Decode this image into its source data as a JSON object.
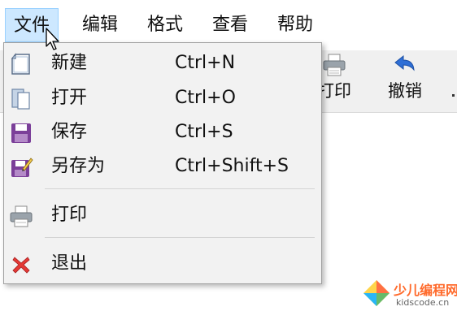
{
  "menubar": {
    "items": [
      {
        "label": "文件",
        "active": true
      },
      {
        "label": "编辑"
      },
      {
        "label": "格式"
      },
      {
        "label": "查看"
      },
      {
        "label": "帮助"
      }
    ]
  },
  "toolbar": {
    "buttons": [
      {
        "label": "打印",
        "icon": "printer-icon"
      },
      {
        "label": "撤销",
        "icon": "undo-icon"
      }
    ]
  },
  "file_menu": {
    "items": [
      {
        "label": "新建",
        "shortcut": "Ctrl+N",
        "icon": "new-document-icon"
      },
      {
        "label": "打开",
        "shortcut": "Ctrl+O",
        "icon": "open-document-icon"
      },
      {
        "label": "保存",
        "shortcut": "Ctrl+S",
        "icon": "save-disk-icon"
      },
      {
        "label": "另存为",
        "shortcut": "Ctrl+Shift+S",
        "icon": "save-as-disk-icon"
      },
      {
        "label": "打印",
        "shortcut": "",
        "icon": "printer-icon"
      },
      {
        "label": "退出",
        "shortcut": "",
        "icon": "exit-x-icon"
      }
    ]
  },
  "watermark": {
    "title": "少儿编程网",
    "url": "kidscode.cn"
  },
  "colors": {
    "active_menu_bg": "#cde8ff",
    "menu_bg": "#f2f2f2",
    "save_icon": "#7b3f99",
    "exit_icon": "#e53935",
    "undo_icon": "#2f6fd6"
  }
}
